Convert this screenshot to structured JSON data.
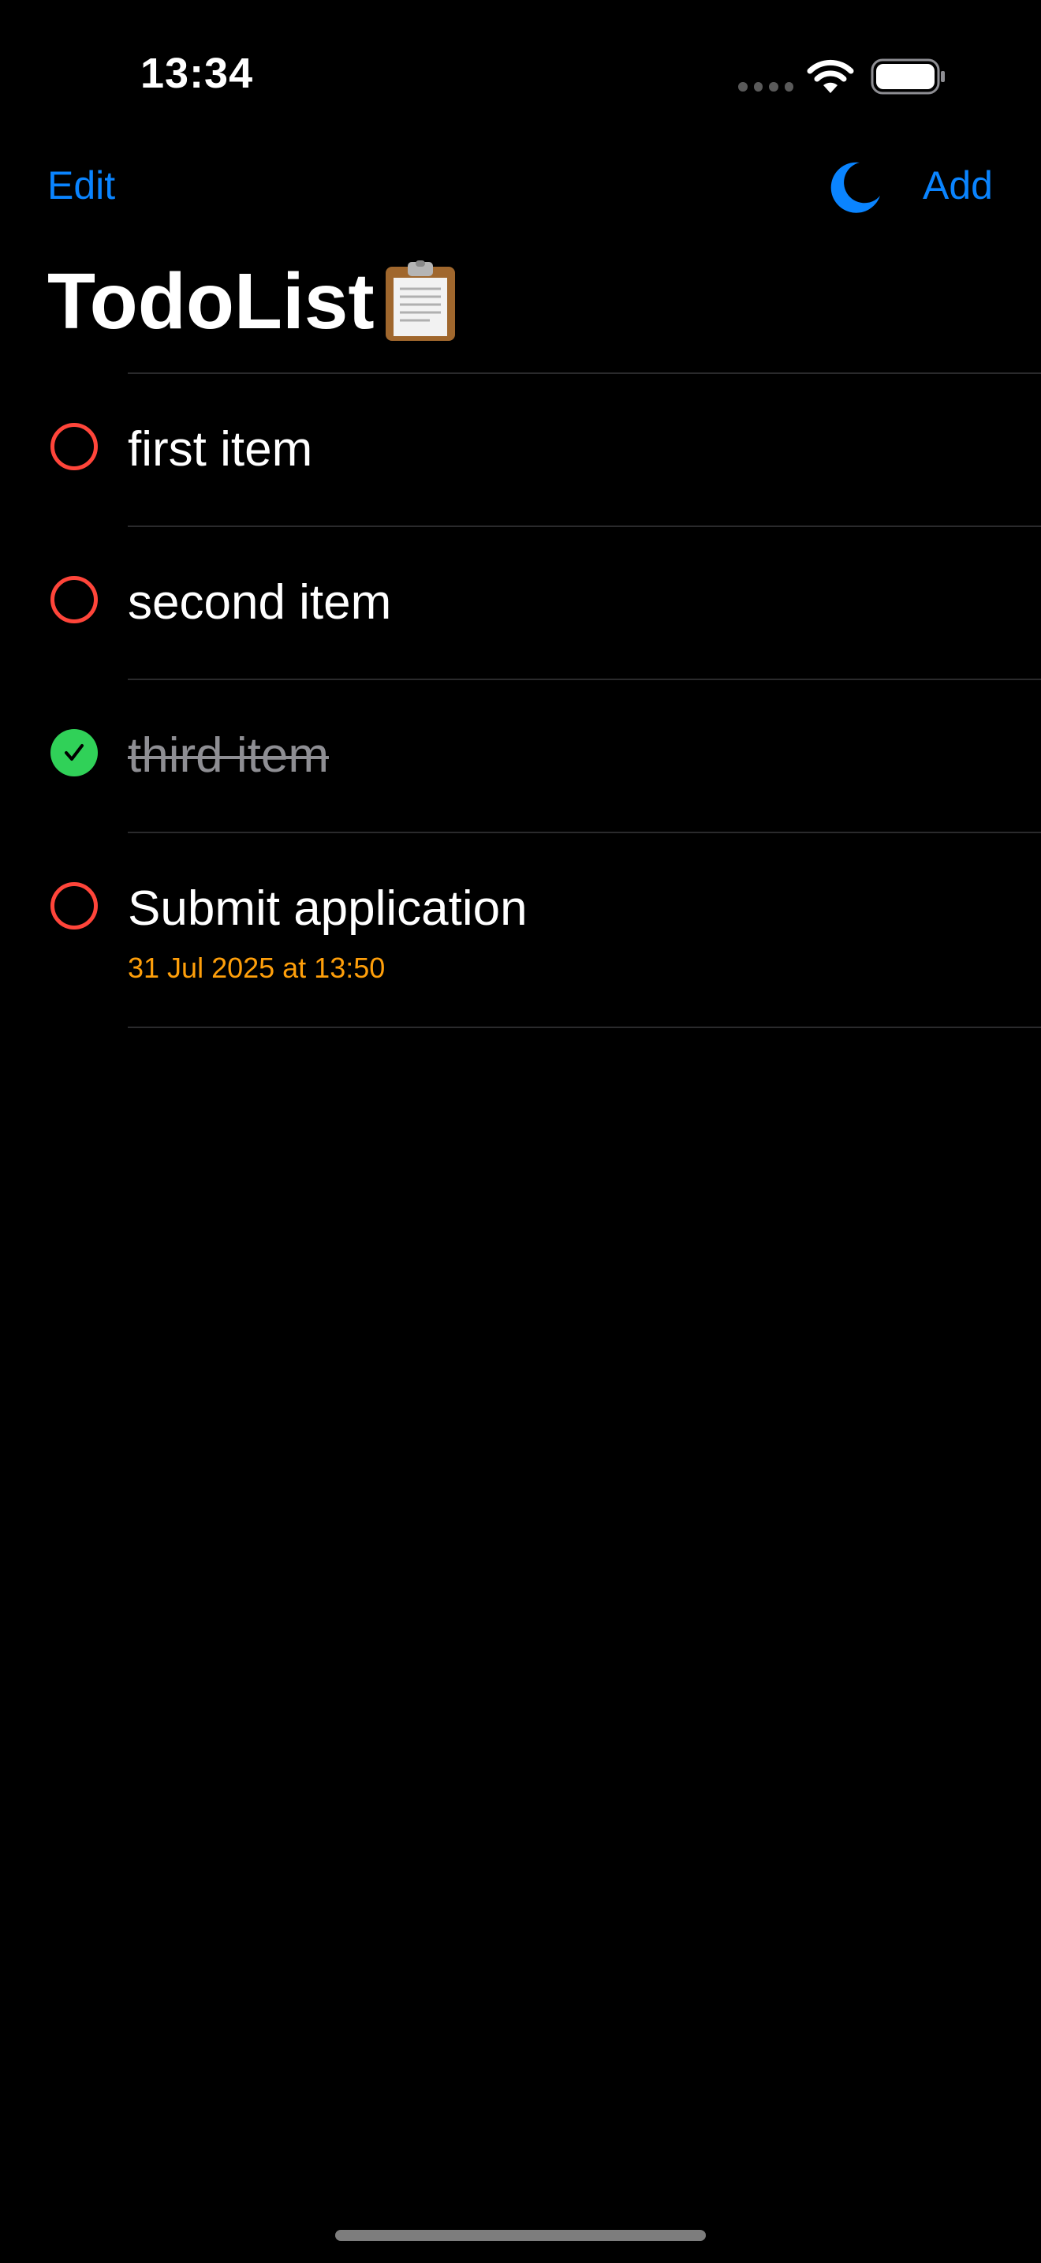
{
  "status_bar": {
    "time": "13:34",
    "icons": [
      "cellular-dots-icon",
      "wifi-icon",
      "battery-icon"
    ]
  },
  "nav": {
    "edit_label": "Edit",
    "add_label": "Add",
    "theme_icon": "moon-icon",
    "accent_color": "#0a84ff"
  },
  "title": {
    "text": "TodoList",
    "icon": "clipboard-icon"
  },
  "todos": [
    {
      "title": "first item",
      "done": false
    },
    {
      "title": "second item",
      "done": false
    },
    {
      "title": "third item",
      "done": true
    },
    {
      "title": "Submit application",
      "done": false,
      "due": "31 Jul 2025 at 13:50"
    }
  ],
  "colors": {
    "background": "#000000",
    "open_circle": "#ff453a",
    "done_circle": "#30d158",
    "due_date": "#ff9f0a",
    "done_text": "#8e8e93"
  }
}
